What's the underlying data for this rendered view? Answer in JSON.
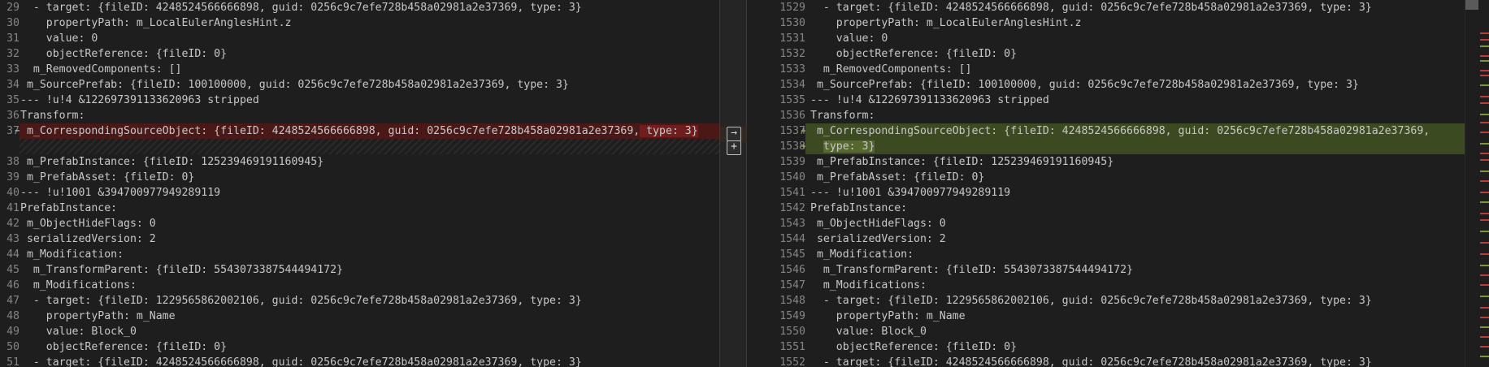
{
  "left": {
    "lines": [
      {
        "no": "29",
        "text": "  - target: {fileID: 4248524566666898, guid: 0256c9c7efe728b458a02981a2e37369, type: 3}",
        "state": "normal"
      },
      {
        "no": "30",
        "text": "    propertyPath: m_LocalEulerAnglesHint.z",
        "state": "normal"
      },
      {
        "no": "31",
        "text": "    value: 0",
        "state": "normal"
      },
      {
        "no": "32",
        "text": "    objectReference: {fileID: 0}",
        "state": "normal"
      },
      {
        "no": "33",
        "text": "  m_RemovedComponents: []",
        "state": "normal"
      },
      {
        "no": "34",
        "text": " m_SourcePrefab: {fileID: 100100000, guid: 0256c9c7efe728b458a02981a2e37369, type: 3}",
        "state": "normal"
      },
      {
        "no": "35",
        "text": "--- !u!4 &122697391133620963 stripped",
        "state": "normal"
      },
      {
        "no": "36",
        "text": "Transform:",
        "state": "normal"
      },
      {
        "no": "37",
        "mark": "−",
        "text": " m_CorrespondingSourceObject: {fileID: 4248524566666898, guid: 0256c9c7efe728b458a02981a2e37369,",
        "hl": " type: 3}",
        "state": "deleted"
      },
      {
        "no": "",
        "text": "",
        "state": "filler"
      },
      {
        "no": "38",
        "text": " m_PrefabInstance: {fileID: 125239469191160945}",
        "state": "normal"
      },
      {
        "no": "39",
        "text": " m_PrefabAsset: {fileID: 0}",
        "state": "normal"
      },
      {
        "no": "40",
        "text": "--- !u!1001 &394700977949289119",
        "state": "normal"
      },
      {
        "no": "41",
        "text": "PrefabInstance:",
        "state": "normal"
      },
      {
        "no": "42",
        "text": " m_ObjectHideFlags: 0",
        "state": "normal"
      },
      {
        "no": "43",
        "text": " serializedVersion: 2",
        "state": "normal"
      },
      {
        "no": "44",
        "text": " m_Modification:",
        "state": "normal"
      },
      {
        "no": "45",
        "text": "  m_TransformParent: {fileID: 5543073387544494172}",
        "state": "normal"
      },
      {
        "no": "46",
        "text": "  m_Modifications:",
        "state": "normal"
      },
      {
        "no": "47",
        "text": "  - target: {fileID: 1229565862002106, guid: 0256c9c7efe728b458a02981a2e37369, type: 3}",
        "state": "normal"
      },
      {
        "no": "48",
        "text": "    propertyPath: m_Name",
        "state": "normal"
      },
      {
        "no": "49",
        "text": "    value: Block_0",
        "state": "normal"
      },
      {
        "no": "50",
        "text": "    objectReference: {fileID: 0}",
        "state": "normal"
      },
      {
        "no": "51",
        "text": "  - target: {fileID: 4248524566666898, guid: 0256c9c7efe728b458a02981a2e37369, type: 3}",
        "state": "normal"
      }
    ]
  },
  "right": {
    "lines": [
      {
        "no": "1529",
        "text": "  - target: {fileID: 4248524566666898, guid: 0256c9c7efe728b458a02981a2e37369, type: 3}",
        "state": "normal"
      },
      {
        "no": "1530",
        "text": "    propertyPath: m_LocalEulerAnglesHint.z",
        "state": "normal"
      },
      {
        "no": "1531",
        "text": "    value: 0",
        "state": "normal"
      },
      {
        "no": "1532",
        "text": "    objectReference: {fileID: 0}",
        "state": "normal"
      },
      {
        "no": "1533",
        "text": "  m_RemovedComponents: []",
        "state": "normal"
      },
      {
        "no": "1534",
        "text": " m_SourcePrefab: {fileID: 100100000, guid: 0256c9c7efe728b458a02981a2e37369, type: 3}",
        "state": "normal"
      },
      {
        "no": "1535",
        "text": "--- !u!4 &122697391133620963 stripped",
        "state": "normal"
      },
      {
        "no": "1536",
        "text": "Transform:",
        "state": "normal"
      },
      {
        "no": "1537",
        "mark": "+",
        "text": " m_CorrespondingSourceObject: {fileID: 4248524566666898, guid: 0256c9c7efe728b458a02981a2e37369,",
        "hl": "",
        "state": "added"
      },
      {
        "no": "1538",
        "mark": "+",
        "text": "  ",
        "hl": "type: 3}",
        "state": "added"
      },
      {
        "no": "1539",
        "text": " m_PrefabInstance: {fileID: 125239469191160945}",
        "state": "normal"
      },
      {
        "no": "1540",
        "text": " m_PrefabAsset: {fileID: 0}",
        "state": "normal"
      },
      {
        "no": "1541",
        "text": "--- !u!1001 &394700977949289119",
        "state": "normal"
      },
      {
        "no": "1542",
        "text": "PrefabInstance:",
        "state": "normal"
      },
      {
        "no": "1543",
        "text": " m_ObjectHideFlags: 0",
        "state": "normal"
      },
      {
        "no": "1544",
        "text": " serializedVersion: 2",
        "state": "normal"
      },
      {
        "no": "1545",
        "text": " m_Modification:",
        "state": "normal"
      },
      {
        "no": "1546",
        "text": "  m_TransformParent: {fileID: 5543073387544494172}",
        "state": "normal"
      },
      {
        "no": "1547",
        "text": "  m_Modifications:",
        "state": "normal"
      },
      {
        "no": "1548",
        "text": "  - target: {fileID: 1229565862002106, guid: 0256c9c7efe728b458a02981a2e37369, type: 3}",
        "state": "normal"
      },
      {
        "no": "1549",
        "text": "    propertyPath: m_Name",
        "state": "normal"
      },
      {
        "no": "1550",
        "text": "    value: Block_0",
        "state": "normal"
      },
      {
        "no": "1551",
        "text": "    objectReference: {fileID: 0}",
        "state": "normal"
      },
      {
        "no": "1552",
        "text": "  - target: {fileID: 4248524566666898, guid: 0256c9c7efe728b458a02981a2e37369, type: 3}",
        "state": "normal"
      }
    ]
  },
  "divider": {
    "revert_arrow_icon": "→",
    "revert_plus_icon": "+"
  },
  "colors": {
    "deleted_bg": "#4b1818",
    "deleted_hl": "#6f1d1d",
    "added_bg": "#3b4a20",
    "added_hl": "#55692e"
  }
}
